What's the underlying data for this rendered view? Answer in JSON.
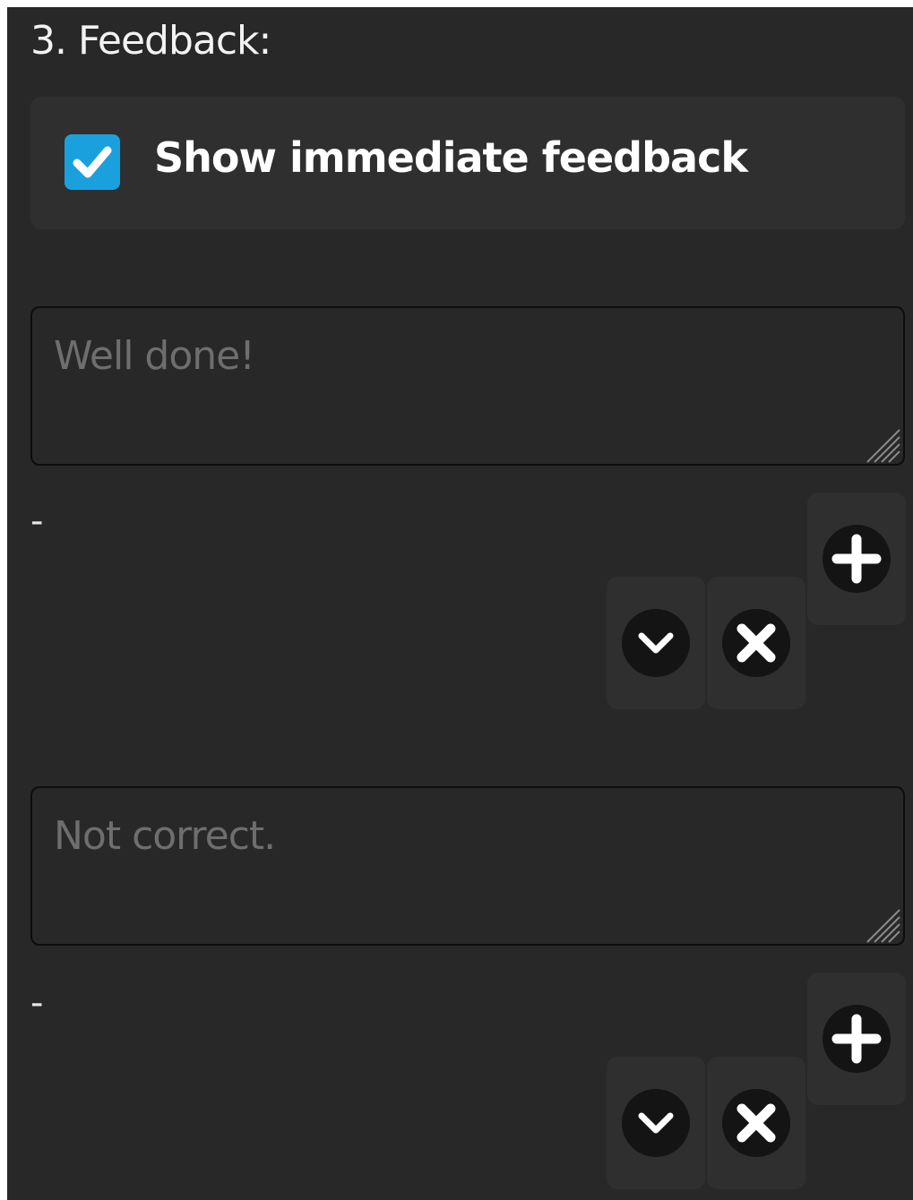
{
  "section": {
    "title": "3. Feedback:"
  },
  "immediate_feedback": {
    "label": "Show immediate feedback",
    "checked": true,
    "accent": "#1aa1dd"
  },
  "feedback_items": [
    {
      "placeholder": "Well done!",
      "score": "-",
      "icons": [
        "plus-icon",
        "chevron-down-icon",
        "close-icon"
      ]
    },
    {
      "placeholder": "Not correct.",
      "score": "-",
      "icons": [
        "plus-icon",
        "chevron-down-icon",
        "close-icon"
      ]
    }
  ]
}
